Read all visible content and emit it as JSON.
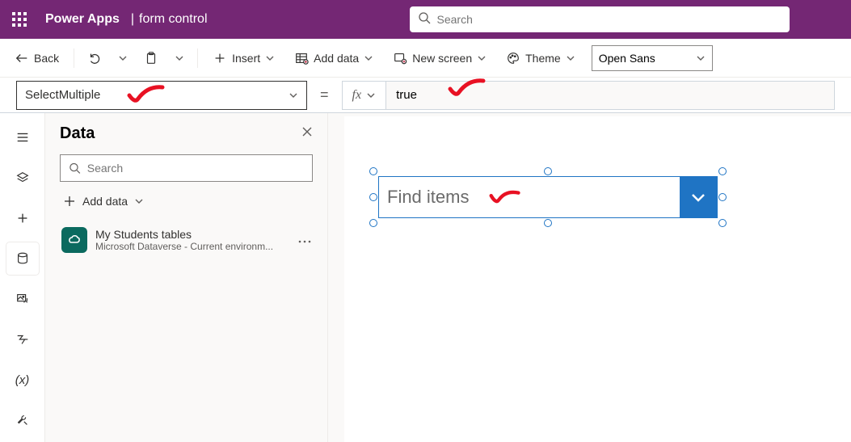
{
  "header": {
    "app_name": "Power Apps",
    "page_name": "form control",
    "search_placeholder": "Search"
  },
  "commandbar": {
    "back": "Back",
    "insert": "Insert",
    "add_data": "Add data",
    "new_screen": "New screen",
    "theme": "Theme",
    "font": "Open Sans"
  },
  "formulabar": {
    "property": "SelectMultiple",
    "fx_label": "fx",
    "formula": "true"
  },
  "datapanel": {
    "title": "Data",
    "search_placeholder": "Search",
    "add_data": "Add data",
    "sources": [
      {
        "name": "My Students tables",
        "subtitle": "Microsoft Dataverse - Current environm..."
      }
    ]
  },
  "canvas": {
    "combobox_placeholder": "Find items"
  }
}
